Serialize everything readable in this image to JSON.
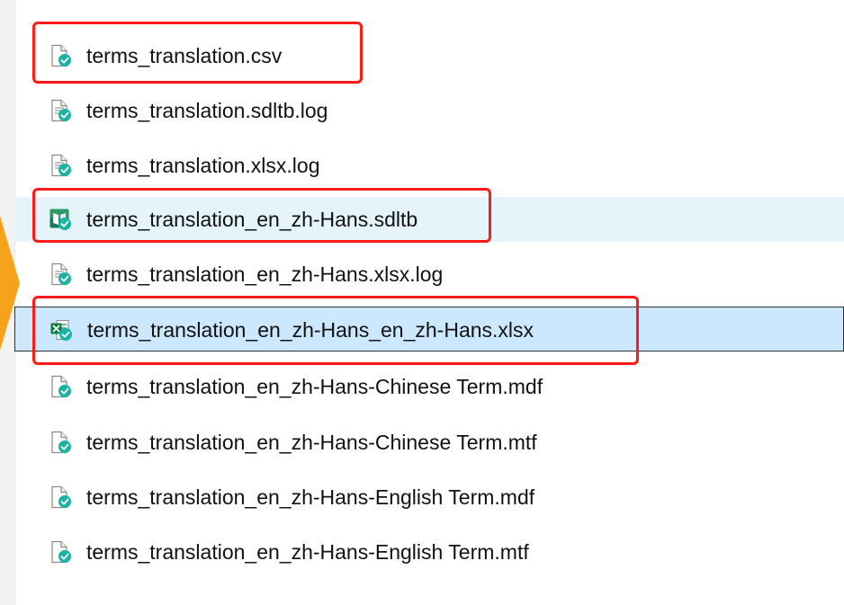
{
  "explorer": {
    "files": [
      {
        "name": "terms_translation.csv",
        "icon": "generic-file-sync-icon",
        "state": "normal",
        "highlighted": true
      },
      {
        "name": "terms_translation.sdltb.log",
        "icon": "text-file-sync-icon",
        "state": "normal",
        "highlighted": false
      },
      {
        "name": "terms_translation.xlsx.log",
        "icon": "text-file-sync-icon",
        "state": "normal",
        "highlighted": false
      },
      {
        "name": "terms_translation_en_zh-Hans.sdltb",
        "icon": "sdltb-book-sync-icon",
        "state": "hover",
        "highlighted": true
      },
      {
        "name": "terms_translation_en_zh-Hans.xlsx.log",
        "icon": "text-file-sync-icon",
        "state": "normal",
        "highlighted": false
      },
      {
        "name": "terms_translation_en_zh-Hans_en_zh-Hans.xlsx",
        "icon": "excel-file-sync-icon",
        "state": "selected",
        "highlighted": true
      },
      {
        "name": "terms_translation_en_zh-Hans-Chinese Term.mdf",
        "icon": "generic-file-sync-icon",
        "state": "normal",
        "highlighted": false
      },
      {
        "name": "terms_translation_en_zh-Hans-Chinese Term.mtf",
        "icon": "generic-file-sync-icon",
        "state": "normal",
        "highlighted": false
      },
      {
        "name": "terms_translation_en_zh-Hans-English Term.mdf",
        "icon": "generic-file-sync-icon",
        "state": "normal",
        "highlighted": false
      },
      {
        "name": "terms_translation_en_zh-Hans-English Term.mtf",
        "icon": "generic-file-sync-icon",
        "state": "normal",
        "highlighted": false
      }
    ]
  },
  "colors": {
    "annotation_red": "#ff1a1a",
    "arrow_orange": "#f7a21b",
    "hover_bg": "#e5f3fb",
    "selected_bg": "#cce8ff",
    "sync_check": "#1bb3a6"
  }
}
